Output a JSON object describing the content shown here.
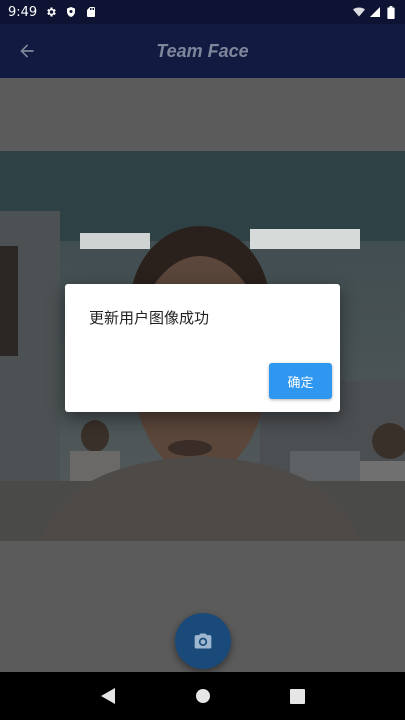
{
  "status_bar": {
    "time": "9:49",
    "icons_left": [
      "settings-icon",
      "shield-icon",
      "sd-card-icon"
    ],
    "icons_right": [
      "wifi-icon",
      "cell-signal-icon",
      "battery-icon"
    ]
  },
  "app_bar": {
    "title": "Team Face",
    "back_icon": "arrow-back-icon"
  },
  "dialog": {
    "message": "更新用户图像成功",
    "confirm_label": "确定"
  },
  "fab": {
    "icon": "camera-icon"
  },
  "colors": {
    "app_bar_bg": "#111a40",
    "dialog_button": "#2f97ef",
    "fab_bg": "#1a4a7a"
  }
}
